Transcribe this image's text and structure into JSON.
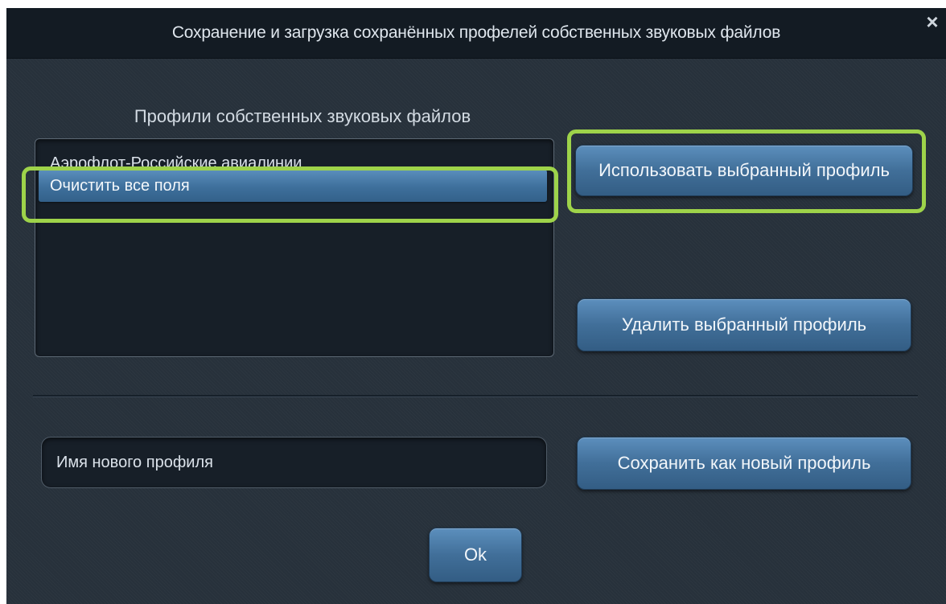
{
  "dialog": {
    "title": "Сохранение и загрузка сохранённых профелей собственных звуковых файлов",
    "close_label": "×"
  },
  "profiles": {
    "section_label": "Профили собственных звуковых файлов",
    "items": [
      {
        "label": "Аэрофлот-Российские авиалинии"
      },
      {
        "label": "Очистить все поля",
        "selected": true
      }
    ]
  },
  "buttons": {
    "use_selected": "Использовать выбранный профиль",
    "delete_selected": "Удалить выбранный профиль",
    "save_new": "Сохранить как новый профиль",
    "ok": "Ok"
  },
  "new_profile": {
    "placeholder": "Имя нового профиля"
  },
  "colors": {
    "highlight": "#9ed34a",
    "button": "#416f99",
    "background": "#27313b"
  }
}
